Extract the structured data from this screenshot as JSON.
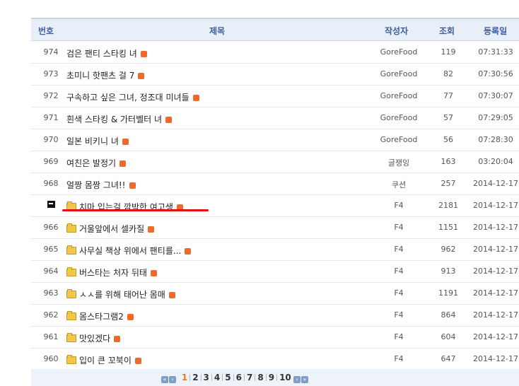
{
  "header": {
    "num": "번호",
    "title": "제목",
    "author": "작성자",
    "views": "조회",
    "date": "등록일"
  },
  "rows": [
    {
      "num": "974",
      "title": "검은 팬티 스타킹 녀",
      "author": "GoreFood",
      "views": "119",
      "date": "07:31:33",
      "folder": false
    },
    {
      "num": "973",
      "title": "초미니 핫팬츠 걸 7",
      "author": "GoreFood",
      "views": "82",
      "date": "07:30:56",
      "folder": false
    },
    {
      "num": "972",
      "title": "구속하고 싶은 그녀, 정조대 미녀들",
      "author": "GoreFood",
      "views": "77",
      "date": "07:30:07",
      "folder": false
    },
    {
      "num": "971",
      "title": "흰색 스타킹 & 가터벨터 녀",
      "author": "GoreFood",
      "views": "57",
      "date": "07:29:05",
      "folder": false
    },
    {
      "num": "970",
      "title": "일본 비키니 녀",
      "author": "GoreFood",
      "views": "56",
      "date": "07:28:30",
      "folder": false
    },
    {
      "num": "969",
      "title": "여친은 발정기",
      "author": "글쟁잉",
      "views": "163",
      "date": "03:20:04",
      "folder": false
    },
    {
      "num": "968",
      "title": "얼짱 몸짱 그녀!!",
      "author": "쿠션",
      "views": "257",
      "date": "2014-12-17",
      "folder": false
    },
    {
      "num": "",
      "title": "치마 입는걸 깜박한 여고생",
      "author": "F4",
      "views": "2181",
      "date": "2014-12-17",
      "folder": true,
      "current": true
    },
    {
      "num": "966",
      "title": "거울앞에서 셀카질",
      "author": "F4",
      "views": "1151",
      "date": "2014-12-17",
      "folder": true
    },
    {
      "num": "965",
      "title": "사무실 책상 위에서 팬티를...",
      "author": "F4",
      "views": "962",
      "date": "2014-12-17",
      "folder": true
    },
    {
      "num": "964",
      "title": "버스타는 처자 뒤태",
      "author": "F4",
      "views": "913",
      "date": "2014-12-17",
      "folder": true
    },
    {
      "num": "963",
      "title": "ㅅㅅ를 위해 태어난 몸매",
      "author": "F4",
      "views": "1191",
      "date": "2014-12-17",
      "folder": true
    },
    {
      "num": "962",
      "title": "몸스타그램2",
      "author": "F4",
      "views": "864",
      "date": "2014-12-17",
      "folder": true
    },
    {
      "num": "961",
      "title": "맛있겠다",
      "author": "F4",
      "views": "604",
      "date": "2014-12-17",
      "folder": true
    },
    {
      "num": "960",
      "title": "입이 큰 꼬북이",
      "author": "F4",
      "views": "647",
      "date": "2014-12-17",
      "folder": true
    }
  ],
  "pagination": {
    "pages": [
      "1",
      "2",
      "3",
      "4",
      "5",
      "6",
      "7",
      "8",
      "9",
      "10"
    ],
    "current": "1"
  }
}
